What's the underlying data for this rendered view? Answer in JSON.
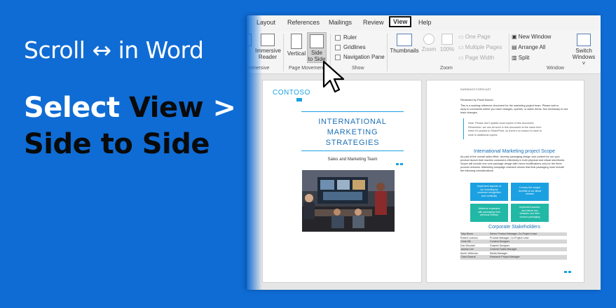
{
  "headline": "Scroll ↔ in Word",
  "instruction": {
    "part1": "Select ",
    "part2": "View",
    "part3": " >",
    "part4": "Side to Side"
  },
  "ribbon": {
    "tabs": [
      "Layout",
      "References",
      "Mailings",
      "Review",
      "View",
      "Help"
    ],
    "views_group_label": "mmersive",
    "immersive_reader": [
      "Immersive",
      "Reader"
    ],
    "vertical": "Vertical",
    "side_to_side": [
      "Side",
      "to Side"
    ],
    "page_movement_label": "Page Movement",
    "show": {
      "ruler": "Ruler",
      "gridlines": "Gridlines",
      "navigation_pane": "Navigation Pane",
      "label": "Show"
    },
    "zoom": {
      "thumbnails": "Thumbnails",
      "zoom": "Zoom",
      "percent": "100%",
      "one_page": "One Page",
      "multiple_pages": "Multiple Pages",
      "page_width": "Page Width",
      "label": "Zoom"
    },
    "window": {
      "new_window": "New Window",
      "arrange_all": "Arrange All",
      "split": "Split",
      "switch_windows": [
        "Switch",
        "Windows ˅"
      ],
      "label": "Window"
    }
  },
  "page1": {
    "logo": "CONTOSO",
    "title": [
      "INTERNATIONAL",
      "MARKETING",
      "STRATEGIES"
    ],
    "subtitle": "Sales and Marketing Team"
  },
  "page2": {
    "header": "EARNINGS FORECAST",
    "reviewed": "Reviewed by Pavel Bondo",
    "intro": [
      "This is a working reference document for the marketing project team. Please add or",
      "reply to comments where you have changes, queries, or action items. Not necessary to use",
      "track changes."
    ],
    "note": [
      "Note: Please don't update local copies of this document.",
      "Remember, we can all work in this document at the same time",
      "when it's posted to SharePoint, so there's no reason to have to",
      "work in additional copies."
    ],
    "scope_title": "International Marketing project Scope",
    "scope_text": [
      "As part of the overall sales effort, develop packaging design and content for our your",
      "product launch that reaches customers effectively in both physical and virtual storefronts.",
      "",
      "Scope will include one core package design with minor modifications only for the three",
      "product versions. Marketing campaign research shows that final packaging must include",
      "the following considerations:"
    ],
    "boxes": [
      [
        "Implement aspects of",
        "our branding for",
        "customer recognition",
        "and continuity"
      ],
      [
        "Convey the unique",
        "benefits of our latest",
        "release"
      ],
      [
        "Minimize expenses",
        "with packaging from",
        "previous release"
      ],
      [
        "Implement access-",
        "and-failure key",
        "between one form",
        "version packaging"
      ]
    ],
    "stakeholders_title": "Corporate Stakeholders",
    "stakeholders": [
      [
        "Toby Nixon",
        "Senior Product Manager, Co-Project Lead"
      ],
      [
        "Robert Lorenzo",
        "Product Manager, Co-Project Lead"
      ],
      [
        "Chris Hill",
        "Content Designer"
      ],
      [
        "Dan Woodall",
        "Graphic Designer"
      ],
      [
        "Joanna Lee",
        "Channel Sales Manager"
      ],
      [
        "Annie Vetterson",
        "Media Manager"
      ],
      [
        "Chloe Bowral",
        "Research Project Manager"
      ]
    ]
  },
  "colors": {
    "background": "#0f6cd4",
    "accent": "#1ba1e2"
  }
}
